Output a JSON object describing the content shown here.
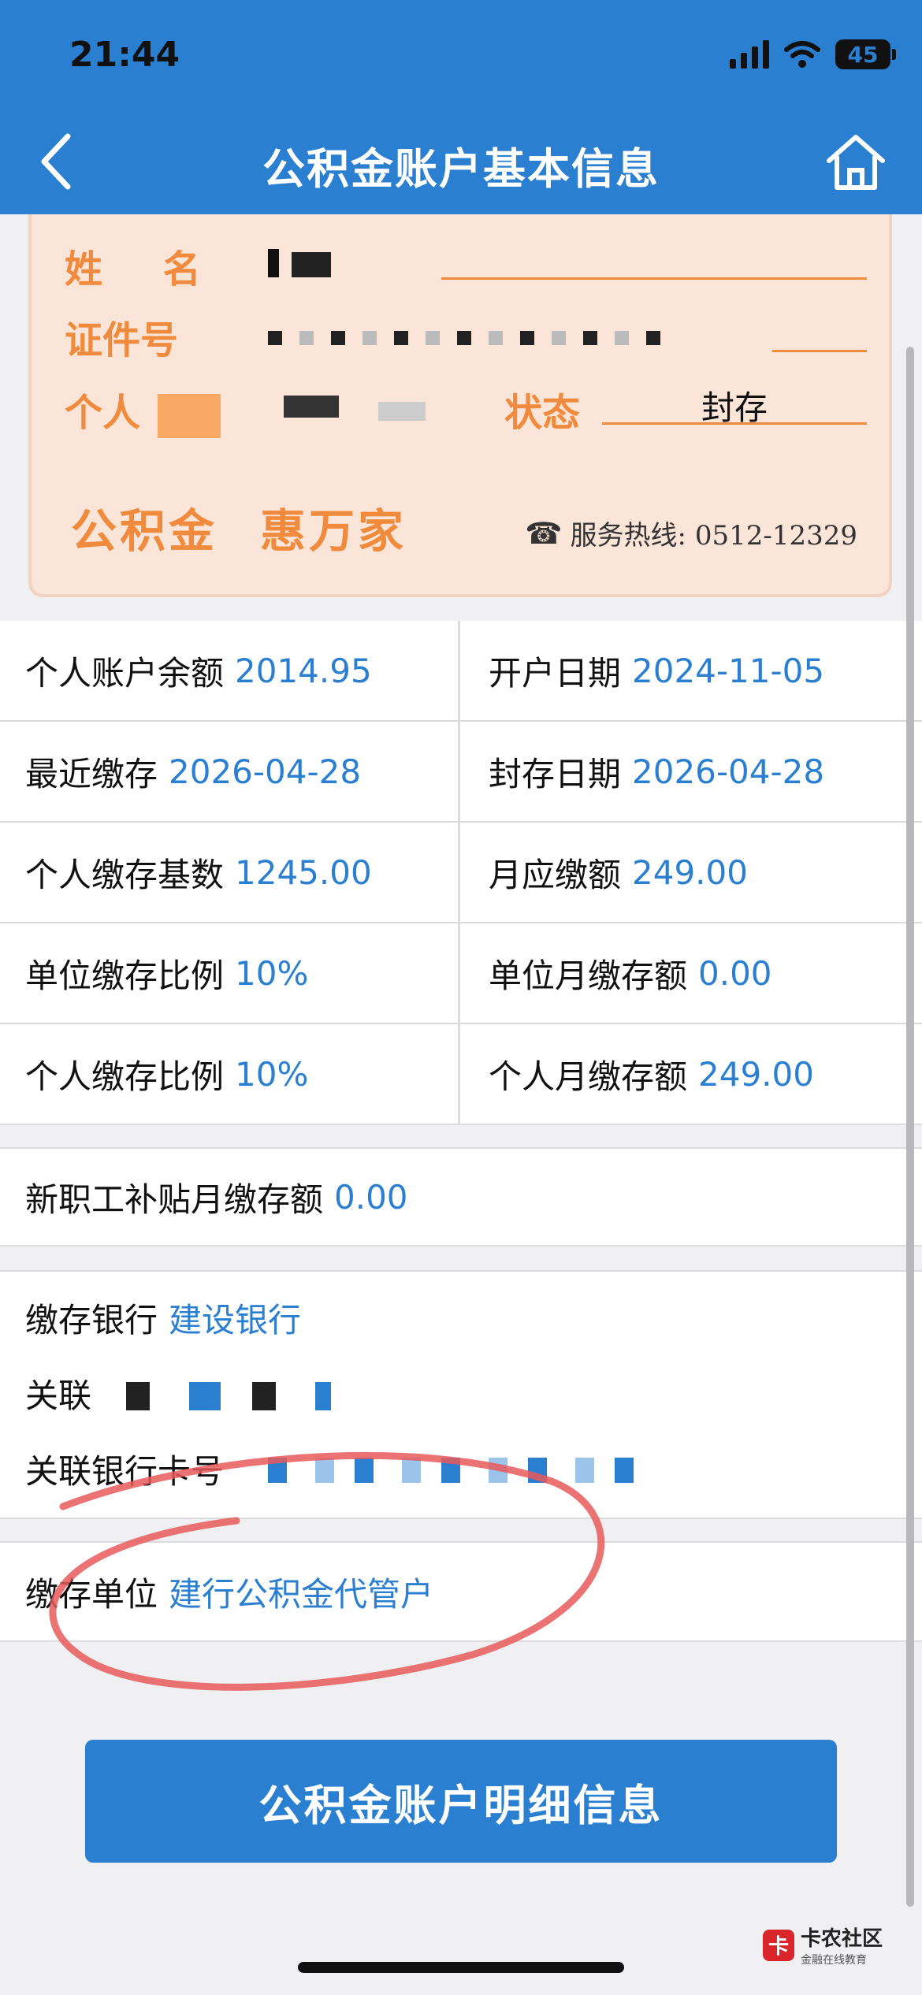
{
  "status_bar": {
    "time": "21:44",
    "battery": "45"
  },
  "header": {
    "title": "公积金账户基本信息"
  },
  "card": {
    "name_label": "姓 名",
    "id_label": "证件号",
    "personal_label": "个人",
    "status_label": "状态",
    "status_value": "封存",
    "brand_left": "公积金",
    "brand_right": "惠万家",
    "hotline": "服务热线: 0512-12329",
    "colors": {
      "accent": "#f08a3c",
      "bg": "#fbe4d8"
    }
  },
  "info_grid": [
    [
      {
        "label": "个人账户余额",
        "value": "2014.95"
      },
      {
        "label": "开户日期",
        "value": "2024-11-05"
      }
    ],
    [
      {
        "label": "最近缴存",
        "value": "2026-04-28"
      },
      {
        "label": "封存日期",
        "value": "2026-04-28"
      }
    ],
    [
      {
        "label": "个人缴存基数",
        "value": "1245.00"
      },
      {
        "label": "月应缴额",
        "value": "249.00"
      }
    ],
    [
      {
        "label": "单位缴存比例",
        "value": "10%"
      },
      {
        "label": "单位月缴存额",
        "value": "0.00"
      }
    ],
    [
      {
        "label": "个人缴存比例",
        "value": "10%"
      },
      {
        "label": "个人月缴存额",
        "value": "249.00"
      }
    ]
  ],
  "subsidy": {
    "label": "新职工补贴月缴存额",
    "value": "0.00"
  },
  "bank": {
    "bank_label": "缴存银行",
    "bank_value": "建设银行",
    "linked_label": "关联",
    "linked_card_label": "关联银行卡号"
  },
  "employer": {
    "label": "缴存单位",
    "value": "建行公积金代管户"
  },
  "detail_button": {
    "label": "公积金账户明细信息"
  },
  "watermark": {
    "title": "卡农社区",
    "subtitle": "金融在线教育"
  },
  "colors": {
    "primary": "#2a7fd0",
    "annotation_circle": "#e85a5a"
  }
}
